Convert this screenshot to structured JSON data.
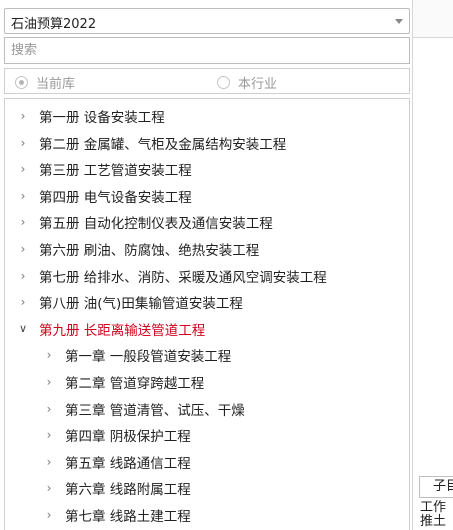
{
  "library": {
    "selected": "石油预算2022"
  },
  "search": {
    "placeholder": "搜索",
    "value": ""
  },
  "scope": {
    "current": "当前库",
    "industry": "本行业"
  },
  "tree": [
    {
      "label": "第一册  设备安装工程",
      "level": 1,
      "expanded": false
    },
    {
      "label": "第二册  金属罐、气柜及金属结构安装工程",
      "level": 1,
      "expanded": false
    },
    {
      "label": "第三册  工艺管道安装工程",
      "level": 1,
      "expanded": false
    },
    {
      "label": "第四册  电气设备安装工程",
      "level": 1,
      "expanded": false
    },
    {
      "label": "第五册  自动化控制仪表及通信安装工程",
      "level": 1,
      "expanded": false
    },
    {
      "label": "第六册  刷油、防腐蚀、绝热安装工程",
      "level": 1,
      "expanded": false
    },
    {
      "label": "第七册  给排水、消防、采暖及通风空调安装工程",
      "level": 1,
      "expanded": false
    },
    {
      "label": "第八册  油(气)田集输管道安装工程",
      "level": 1,
      "expanded": false
    },
    {
      "label": "第九册  长距离输送管道工程",
      "level": 1,
      "expanded": true
    },
    {
      "label": "第一章  一般段管道安装工程",
      "level": 2,
      "expanded": false
    },
    {
      "label": "第二章  管道穿跨越工程",
      "level": 2,
      "expanded": false
    },
    {
      "label": "第三章  管道清管、试压、干燥",
      "level": 2,
      "expanded": false
    },
    {
      "label": "第四章  阴极保护工程",
      "level": 2,
      "expanded": false
    },
    {
      "label": "第五章  线路通信工程",
      "level": 2,
      "expanded": false
    },
    {
      "label": "第六章  线路附属工程",
      "level": 2,
      "expanded": false
    },
    {
      "label": "第七章  线路土建工程",
      "level": 2,
      "expanded": false
    }
  ],
  "right_panel": {
    "tab_label": "子目",
    "work_line1": "工作",
    "work_line2": "推土"
  },
  "colors": {
    "expanded_text": "#d0021b"
  }
}
